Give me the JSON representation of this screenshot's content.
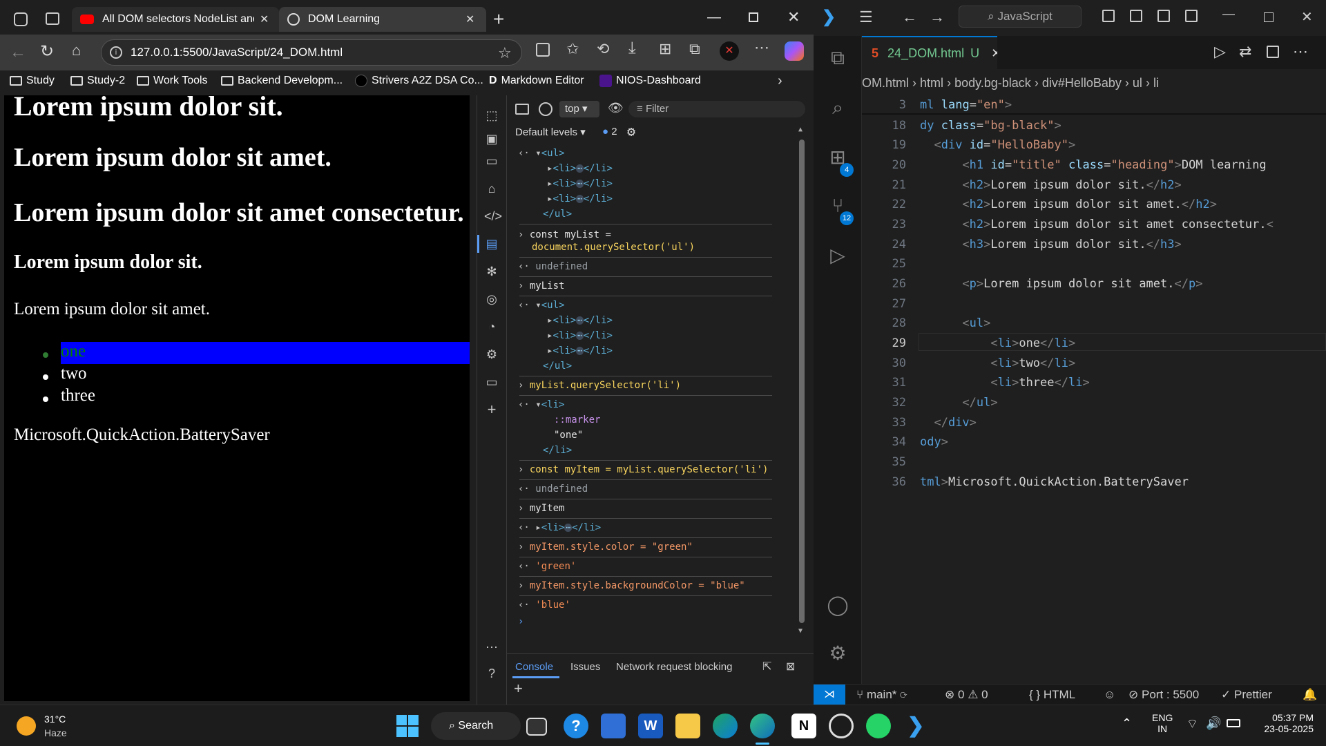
{
  "browser": {
    "tabs": [
      {
        "title": "All DOM selectors NodeList and H"
      },
      {
        "title": "DOM Learning"
      }
    ],
    "url": "127.0.0.1:5500/JavaScript/24_DOM.html",
    "bookmarks": [
      "Study",
      "Study-2",
      "Work Tools",
      "Backend Developm...",
      "Strivers A2Z DSA Co...",
      "Markdown Editor",
      "NIOS-Dashboard"
    ]
  },
  "page": {
    "h1": "Lorem ipsum dolor sit.",
    "h2a": "Lorem ipsum dolor sit amet.",
    "h2b": "Lorem ipsum dolor sit amet consectetur.",
    "h3": "Lorem ipsum dolor sit.",
    "p": "Lorem ipsum dolor sit amet.",
    "items": [
      "one",
      "two",
      "three"
    ],
    "footer_text": "Microsoft.QuickAction.BatterySaver"
  },
  "devtools": {
    "context": "top",
    "filter_placeholder": "Filter",
    "levels": "Default levels",
    "issues_count": "2",
    "tabs": [
      "Console",
      "Issues",
      "Network request blocking"
    ],
    "lines": {
      "ul": "<ul>",
      "li_collapsed": "<li>",
      "li_close": "</li>",
      "ul_close": "</ul>",
      "cmd1a": "const myList =",
      "cmd1b": "document.querySelector('ul')",
      "undef": "undefined",
      "mylist": "myList",
      "cmd2": "myList.querySelector('li')",
      "marker": "::marker",
      "one_str": "\"one\"",
      "cmd3": "const myItem = myList.querySelector('li')",
      "myitem": "myItem",
      "cmd4": "myItem.style.color = \"green\"",
      "res4": "'green'",
      "cmd5": "myItem.style.backgroundColor = \"blue\"",
      "res5": "'blue'"
    }
  },
  "vscode": {
    "search": "JavaScript",
    "file_tab": "24_DOM.html",
    "file_status": "U",
    "breadcrumb": [
      "OM.html",
      "html",
      "body.bg-black",
      "div#HelloBaby",
      "ul",
      "li"
    ],
    "badges": {
      "extensions": "4",
      "source_control": "12"
    },
    "line_numbers": [
      "3",
      "18",
      "19",
      "20",
      "21",
      "22",
      "23",
      "24",
      "25",
      "26",
      "27",
      "28",
      "29",
      "30",
      "31",
      "32",
      "33",
      "34",
      "35",
      "36"
    ],
    "status": {
      "branch": "main*",
      "errors": "0",
      "warnings": "0",
      "language": "HTML",
      "port": "Port : 5500",
      "formatter": "Prettier"
    }
  },
  "taskbar": {
    "temp": "31°C",
    "weather": "Haze",
    "search": "Search",
    "lang1": "ENG",
    "lang2": "IN",
    "time": "05:37 PM",
    "date": "23-05-2025"
  }
}
